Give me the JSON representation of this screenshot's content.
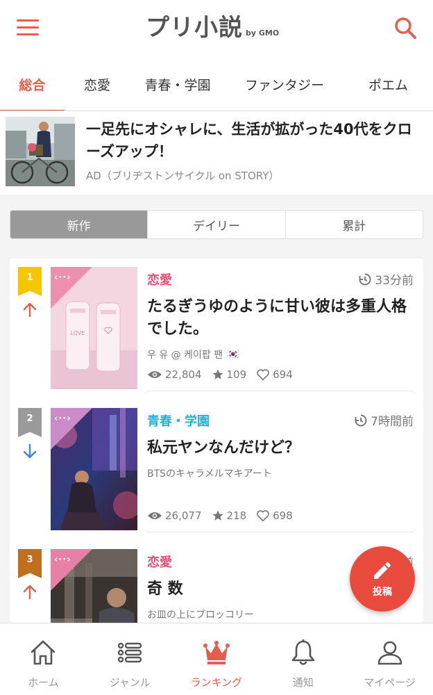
{
  "header": {
    "logo_main": "プリ小説",
    "logo_by": "by GMO"
  },
  "tabs": [
    {
      "label": "総合",
      "active": true
    },
    {
      "label": "恋愛",
      "active": false
    },
    {
      "label": "青春・学園",
      "active": false
    },
    {
      "label": "ファンタジー",
      "active": false
    },
    {
      "label": "ポエム",
      "active": false
    }
  ],
  "ad": {
    "title": "一足先にオシャレに、生活が拡がった40代をクローズアップ！",
    "source": "AD（ブリヂストンサイクル on STORY）"
  },
  "ranking_periods": [
    {
      "label": "新作",
      "active": true
    },
    {
      "label": "デイリー",
      "active": false
    },
    {
      "label": "累計",
      "active": false
    }
  ],
  "cover_tag": "‹··›",
  "ranking": [
    {
      "rank": "1",
      "badge_color": "#f5c500",
      "trend": "up",
      "genre": "恋愛",
      "genre_color": "#e8507a",
      "time": "33分前",
      "title": "たるぎうゆのように甘い彼は多重人格でした。",
      "author": "우 유 @ 케이팝 팬",
      "author_flag": "🇰🇷",
      "views": "22,804",
      "stars": "109",
      "likes": "694"
    },
    {
      "rank": "2",
      "badge_color": "#9a9a9a",
      "trend": "down",
      "genre": "青春・学園",
      "genre_color": "#1fb5d6",
      "time": "7時間前",
      "title": "私元ヤンなんだけど？",
      "author": "BTSのキャラメルマキアート",
      "author_flag": "",
      "views": "26,077",
      "stars": "218",
      "likes": "698"
    },
    {
      "rank": "3",
      "badge_color": "#c0701c",
      "trend": "up",
      "genre": "恋愛",
      "genre_color": "#e8507a",
      "time": "前",
      "title": "奇 数",
      "author": "お皿の上にブロッコリー",
      "author_flag": "",
      "views": "",
      "stars": "",
      "likes": ""
    }
  ],
  "fab": {
    "label": "投稿"
  },
  "bottom_nav": [
    {
      "label": "ホーム",
      "icon": "home-icon",
      "active": false
    },
    {
      "label": "ジャンル",
      "icon": "list-icon",
      "active": false
    },
    {
      "label": "ランキング",
      "icon": "crown-icon",
      "active": true
    },
    {
      "label": "通知",
      "icon": "bell-icon",
      "active": false
    },
    {
      "label": "マイページ",
      "icon": "user-icon",
      "active": false
    }
  ],
  "colors": {
    "accent": "#e65c4f",
    "fab": "#e94a3e",
    "romance": "#e8507a",
    "school": "#1fb5d6",
    "trend_up": "#e65c4f",
    "trend_down": "#3b82e0"
  }
}
